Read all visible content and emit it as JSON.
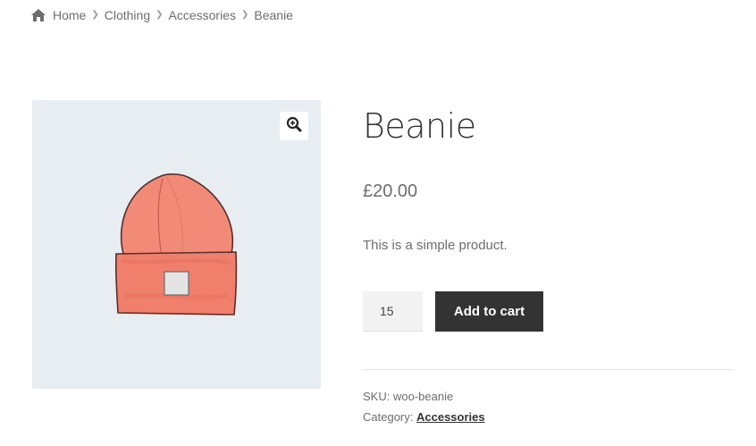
{
  "breadcrumb": {
    "home_label": "Home",
    "items": [
      "Clothing",
      "Accessories"
    ],
    "current": "Beanie"
  },
  "product": {
    "title": "Beanie",
    "price": "£20.00",
    "short_description": "This is a simple product.",
    "quantity": "15",
    "add_to_cart_label": "Add to cart",
    "sku_label": "SKU:",
    "sku_value": "woo-beanie",
    "category_label": "Category:",
    "category_value": "Accessories"
  },
  "icons": {
    "home": "home-icon",
    "zoom": "zoom-in-icon",
    "separator": "chevron-right-icon"
  },
  "colors": {
    "button_bg": "#333333",
    "gallery_bg": "#e8edf2",
    "beanie": "#f08a78"
  }
}
